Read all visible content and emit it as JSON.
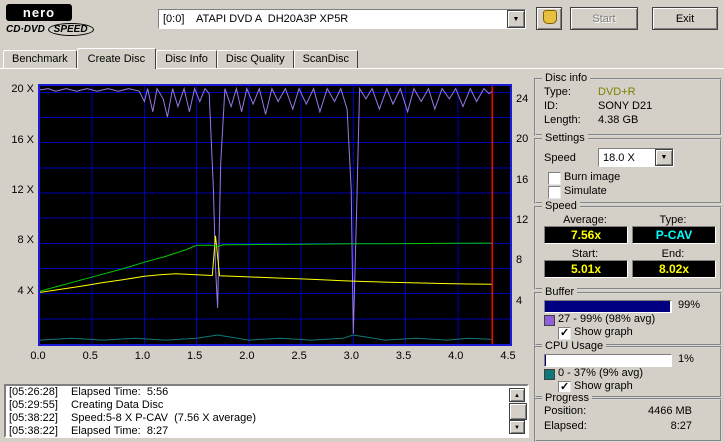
{
  "logo": {
    "name": "nero",
    "line2_left": "CD·DVD",
    "line2_right": "SPEED"
  },
  "toolbar": {
    "drive_combo": "[0:0]    ATAPI DVD A  DH20A3P XP5R",
    "start_label": "Start",
    "exit_label": "Exit"
  },
  "tabs": [
    {
      "label": "Benchmark",
      "active": false
    },
    {
      "label": "Create Disc",
      "active": true
    },
    {
      "label": "Disc Info",
      "active": false
    },
    {
      "label": "Disc Quality",
      "active": false
    },
    {
      "label": "ScanDisc",
      "active": false
    }
  ],
  "accents": {
    "value_text": "#ffff00",
    "type_text": "#00ffff",
    "disc_type_text": "#808000",
    "progress_fill": "#000080",
    "buffer_swatch": "#9060d8",
    "cpu_swatch": "#107878"
  },
  "chart_data": {
    "type": "line",
    "title": "",
    "xlabel": "",
    "ylabel": "",
    "x_range": [
      0,
      4.5
    ],
    "x_ticks": [
      "0.0",
      "0.5",
      "1.0",
      "1.5",
      "2.0",
      "2.5",
      "3.0",
      "3.5",
      "4.0",
      "4.5"
    ],
    "left_axis": {
      "range": [
        0,
        20.5
      ],
      "ticks": [
        4,
        8,
        12,
        16,
        20
      ],
      "labels": [
        "4 X",
        "8 X",
        "12 X",
        "16 X",
        "20 X"
      ]
    },
    "right_axis": {
      "range": [
        0,
        25.6
      ],
      "ticks": [
        4,
        8,
        12,
        16,
        20,
        24
      ]
    },
    "grid": {
      "x_step": 0.5,
      "y_step": 2,
      "color": "#0000b4"
    },
    "position_line": {
      "x": 4.33,
      "color": "#ff0000"
    },
    "series": [
      {
        "name": "buffer-level-percent",
        "color": "#9878e8",
        "axis": "percent",
        "points": [
          [
            0,
            98.5
          ],
          [
            0.08,
            99
          ],
          [
            0.15,
            98
          ],
          [
            0.25,
            99
          ],
          [
            0.35,
            98
          ],
          [
            0.45,
            99
          ],
          [
            0.55,
            98
          ],
          [
            0.65,
            99
          ],
          [
            0.75,
            98
          ],
          [
            0.85,
            99
          ],
          [
            0.95,
            98
          ],
          [
            1.0,
            94
          ],
          [
            1.03,
            99
          ],
          [
            1.08,
            90
          ],
          [
            1.12,
            99
          ],
          [
            1.18,
            95
          ],
          [
            1.22,
            88
          ],
          [
            1.27,
            99
          ],
          [
            1.32,
            92
          ],
          [
            1.38,
            99
          ],
          [
            1.43,
            90
          ],
          [
            1.48,
            99
          ],
          [
            1.53,
            94
          ],
          [
            1.58,
            99
          ],
          [
            1.62,
            97
          ],
          [
            1.66,
            60
          ],
          [
            1.68,
            30
          ],
          [
            1.7,
            14
          ],
          [
            1.73,
            70
          ],
          [
            1.77,
            99
          ],
          [
            1.83,
            92
          ],
          [
            1.88,
            99
          ],
          [
            1.93,
            90
          ],
          [
            1.98,
            99
          ],
          [
            2.04,
            93
          ],
          [
            2.1,
            99
          ],
          [
            2.16,
            89
          ],
          [
            2.22,
            99
          ],
          [
            2.28,
            94
          ],
          [
            2.35,
            99
          ],
          [
            2.42,
            91
          ],
          [
            2.48,
            99
          ],
          [
            2.55,
            93
          ],
          [
            2.62,
            99
          ],
          [
            2.68,
            90
          ],
          [
            2.75,
            99
          ],
          [
            2.82,
            94
          ],
          [
            2.88,
            99
          ],
          [
            2.94,
            91
          ],
          [
            2.98,
            60
          ],
          [
            3.0,
            4
          ],
          [
            3.03,
            50
          ],
          [
            3.06,
            99
          ],
          [
            3.12,
            95
          ],
          [
            3.18,
            99
          ],
          [
            3.25,
            91
          ],
          [
            3.32,
            99
          ],
          [
            3.38,
            93
          ],
          [
            3.45,
            99
          ],
          [
            3.52,
            90
          ],
          [
            3.58,
            99
          ],
          [
            3.65,
            94
          ],
          [
            3.72,
            99
          ],
          [
            3.78,
            91
          ],
          [
            3.85,
            99
          ],
          [
            3.92,
            95
          ],
          [
            3.98,
            99
          ],
          [
            4.05,
            92
          ],
          [
            4.12,
            99
          ],
          [
            4.18,
            94
          ],
          [
            4.25,
            99
          ],
          [
            4.3,
            97
          ],
          [
            4.33,
            98
          ]
        ]
      },
      {
        "name": "cpu-usage-percent",
        "color": "#107878",
        "axis": "percent",
        "points": [
          [
            0,
            1.5
          ],
          [
            0.3,
            2.2
          ],
          [
            0.6,
            1.5
          ],
          [
            0.9,
            2.2
          ],
          [
            1.2,
            1.5
          ],
          [
            1.5,
            2.2
          ],
          [
            1.7,
            3.5
          ],
          [
            2.0,
            1.5
          ],
          [
            2.3,
            2.2
          ],
          [
            2.6,
            1.5
          ],
          [
            2.9,
            2.2
          ],
          [
            3.0,
            3.5
          ],
          [
            3.3,
            1.5
          ],
          [
            3.6,
            2.2
          ],
          [
            3.9,
            1.5
          ],
          [
            4.1,
            2.2
          ],
          [
            4.33,
            1.8
          ]
        ]
      },
      {
        "name": "rotation-speed-yellow",
        "color": "#ffff00",
        "axis": "left",
        "points": [
          [
            0,
            4.1
          ],
          [
            0.2,
            4.35
          ],
          [
            0.4,
            4.6
          ],
          [
            0.6,
            4.88
          ],
          [
            0.8,
            5.12
          ],
          [
            1.0,
            5.38
          ],
          [
            1.15,
            5.5
          ],
          [
            1.3,
            5.58
          ],
          [
            1.45,
            5.52
          ],
          [
            1.6,
            5.46
          ],
          [
            1.65,
            5.44
          ],
          [
            1.68,
            8.6
          ],
          [
            1.72,
            5.42
          ],
          [
            1.9,
            5.36
          ],
          [
            2.1,
            5.3
          ],
          [
            2.3,
            5.24
          ],
          [
            2.5,
            5.17
          ],
          [
            2.7,
            5.1
          ],
          [
            2.9,
            5.03
          ],
          [
            3.1,
            4.97
          ],
          [
            3.3,
            4.92
          ],
          [
            3.5,
            4.88
          ],
          [
            3.7,
            4.84
          ],
          [
            3.9,
            4.8
          ],
          [
            4.1,
            4.77
          ],
          [
            4.33,
            4.74
          ]
        ]
      },
      {
        "name": "write-speed-green",
        "color": "#00cc00",
        "axis": "left",
        "points": [
          [
            0,
            4.2
          ],
          [
            0.2,
            4.65
          ],
          [
            0.4,
            5.1
          ],
          [
            0.6,
            5.55
          ],
          [
            0.8,
            6.0
          ],
          [
            1.0,
            6.5
          ],
          [
            1.2,
            6.95
          ],
          [
            1.4,
            7.5
          ],
          [
            1.5,
            7.85
          ],
          [
            1.65,
            7.85
          ],
          [
            1.7,
            7.75
          ],
          [
            1.75,
            7.88
          ],
          [
            2.0,
            7.9
          ],
          [
            2.5,
            7.93
          ],
          [
            3.0,
            7.96
          ],
          [
            3.5,
            7.98
          ],
          [
            4.0,
            8.0
          ],
          [
            4.33,
            8.02
          ]
        ]
      }
    ]
  },
  "panels": {
    "disc_info": {
      "title": "Disc info",
      "type_label": "Type:",
      "type_value": "DVD+R",
      "id_label": "ID:",
      "id_value": "SONY D21",
      "length_label": "Length:",
      "length_value": "4.38 GB"
    },
    "settings": {
      "title": "Settings",
      "speed_label": "Speed",
      "speed_value": "18.0 X",
      "burn_image_label": "Burn image",
      "burn_image_checked": false,
      "simulate_label": "Simulate",
      "simulate_checked": false
    },
    "speed": {
      "title": "Speed",
      "average_label": "Average:",
      "average": "7.56x",
      "type_label": "Type:",
      "type": "P-CAV",
      "start_label": "Start:",
      "start": "5.01x",
      "end_label": "End:",
      "end": "8.02x"
    },
    "buffer": {
      "title": "Buffer",
      "percent": 99,
      "percent_label": "99%",
      "range": "27 - 99% (98% avg)",
      "show_graph_label": "Show graph",
      "show_graph_checked": true
    },
    "cpu": {
      "title": "CPU Usage",
      "percent": 1,
      "percent_label": "1%",
      "range": "0 - 37% (9% avg)",
      "show_graph_label": "Show graph",
      "show_graph_checked": true
    },
    "progress": {
      "title": "Progress",
      "position_label": "Position:",
      "position_value": "4466 MB",
      "elapsed_label": "Elapsed:",
      "elapsed_value": "8:27"
    }
  },
  "log": {
    "lines": [
      {
        "time": "[05:26:28]",
        "text": "Elapsed Time:  5:56"
      },
      {
        "time": "[05:29:55]",
        "text": "Creating Data Disc"
      },
      {
        "time": "[05:38:22]",
        "text": "Speed:5-8 X P-CAV  (7.56 X average)"
      },
      {
        "time": "[05:38:22]",
        "text": "Elapsed Time:  8:27"
      }
    ]
  }
}
